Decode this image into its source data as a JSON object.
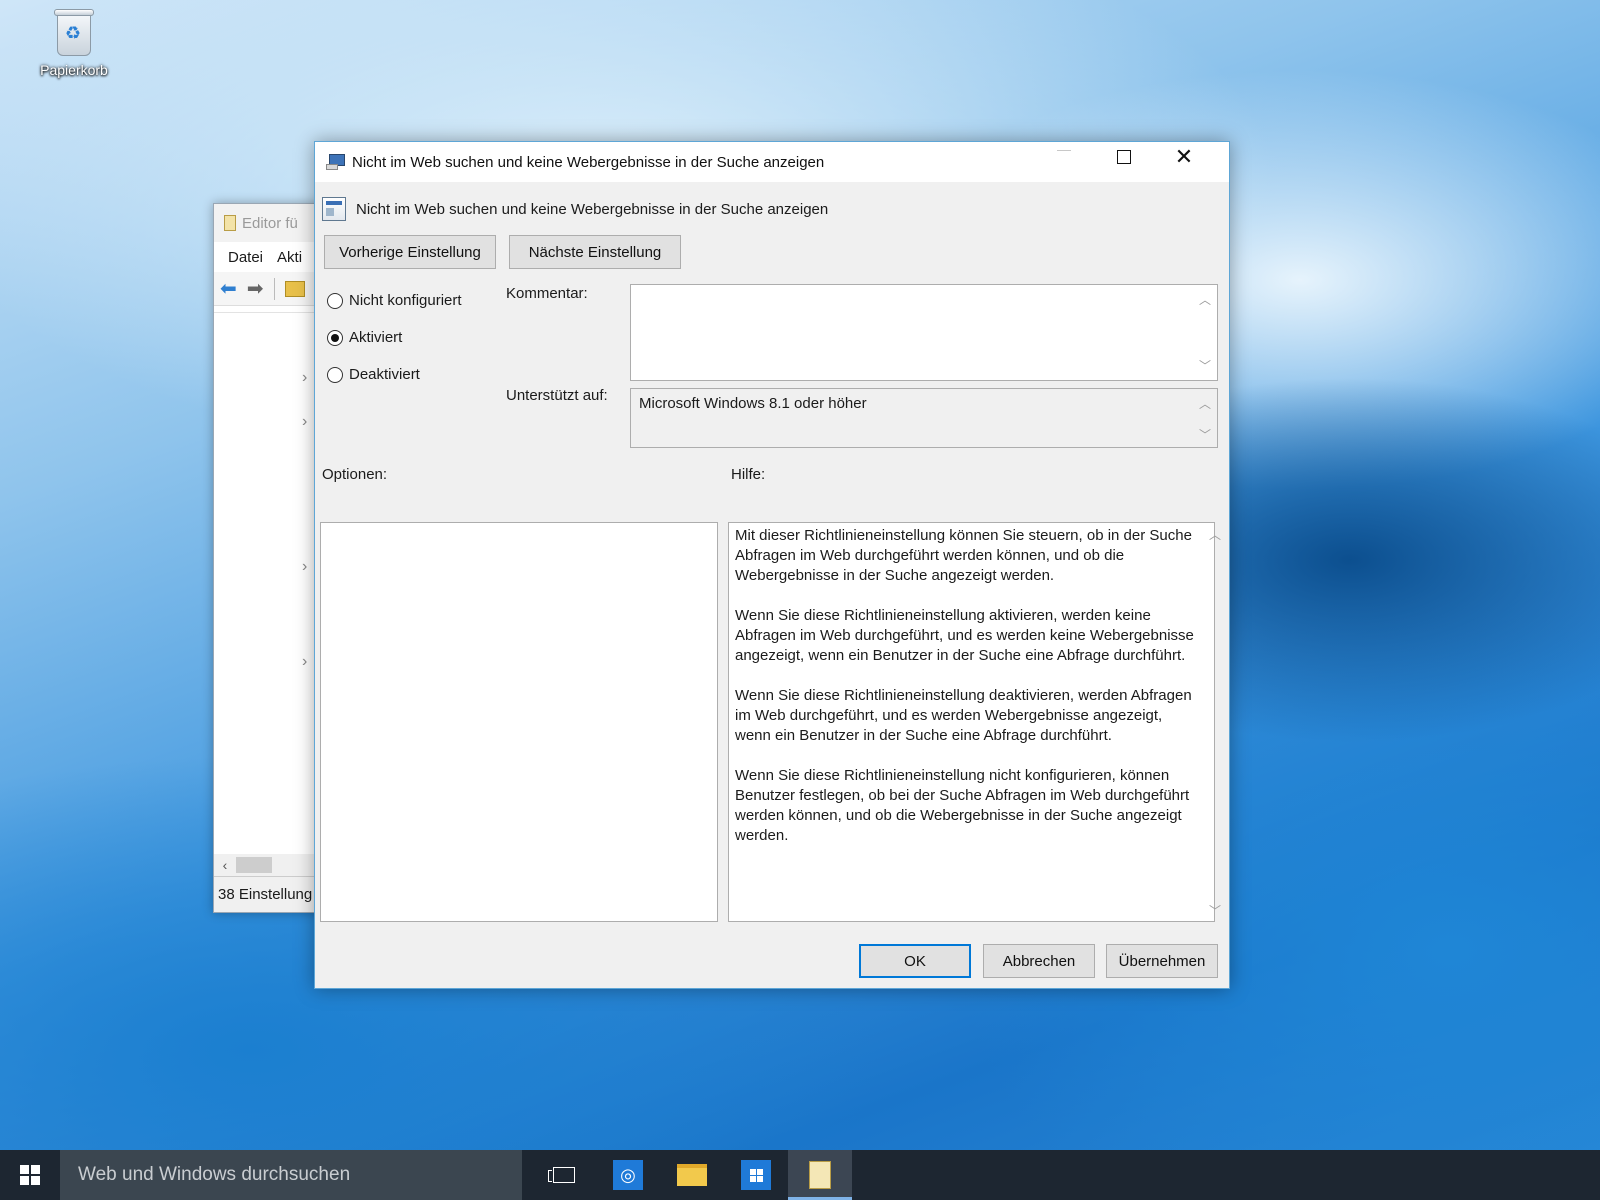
{
  "desktop": {
    "recycle_bin_label": "Papierkorb"
  },
  "background_window": {
    "title": "Editor fü",
    "menu": [
      "Datei",
      "Akti"
    ],
    "status": "38 Einstellung"
  },
  "dialog": {
    "title": "Nicht im Web suchen und keine Webergebnisse in der Suche anzeigen",
    "policy_name": "Nicht im Web suchen und keine Webergebnisse in der Suche anzeigen",
    "prev_button": "Vorherige Einstellung",
    "next_button": "Nächste Einstellung",
    "radios": [
      {
        "label": "Nicht konfiguriert",
        "selected": false
      },
      {
        "label": "Aktiviert",
        "selected": true
      },
      {
        "label": "Deaktiviert",
        "selected": false
      }
    ],
    "comment_label": "Kommentar:",
    "comment_value": "",
    "supported_label": "Unterstützt auf:",
    "supported_value": "Microsoft Windows 8.1 oder höher",
    "options_label": "Optionen:",
    "help_label": "Hilfe:",
    "help_paragraphs": [
      "Mit dieser Richtlinieneinstellung können Sie steuern, ob in der Suche Abfragen im Web durchgeführt werden können, und ob die Webergebnisse in der Suche angezeigt werden.",
      "Wenn Sie diese Richtlinieneinstellung aktivieren, werden keine Abfragen im Web durchgeführt, und es werden keine Webergebnisse angezeigt, wenn ein Benutzer in der Suche eine Abfrage durchführt.",
      "Wenn Sie diese Richtlinieneinstellung deaktivieren, werden Abfragen im Web durchgeführt, und es werden Webergebnisse angezeigt, wenn ein Benutzer in der Suche eine Abfrage durchführt.",
      "Wenn Sie diese Richtlinieneinstellung nicht konfigurieren, können Benutzer festlegen, ob bei der Suche Abfragen im Web durchgeführt werden können, und ob die Webergebnisse in der Suche angezeigt werden."
    ],
    "ok_button": "OK",
    "cancel_button": "Abbrechen",
    "apply_button": "Übernehmen"
  },
  "taskbar": {
    "search_placeholder": "Web und Windows durchsuchen",
    "icons": [
      "task-view-icon",
      "internet-explorer-icon",
      "file-explorer-icon",
      "store-icon",
      "group-policy-editor-icon"
    ]
  }
}
